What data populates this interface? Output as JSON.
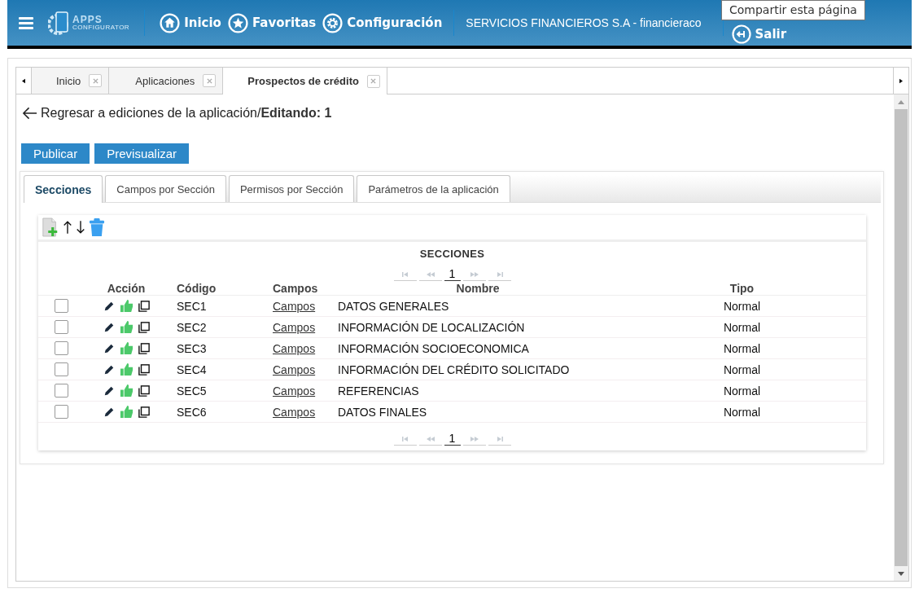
{
  "header": {
    "logo": {
      "line1": "APPS",
      "line2": "CONFIGURATOR"
    },
    "nav": [
      {
        "label": "Inicio",
        "kind": "home"
      },
      {
        "label": "Favoritas",
        "kind": "star"
      },
      {
        "label": "Configuración",
        "kind": "gear"
      }
    ],
    "company": "SERVICIOS FINANCIEROS S.A - financieraco",
    "logout": "Salir",
    "tooltip": "Compartir esta página"
  },
  "doc_tabs": [
    {
      "label": "Inicio",
      "selected": false
    },
    {
      "label": "Aplicaciones",
      "selected": false
    },
    {
      "label": "Prospectos de crédito",
      "selected": true
    }
  ],
  "back_link": "Regresar a ediciones de la aplicación/**Editando: 1**",
  "buttons": [
    "Publicar",
    "Previsualizar"
  ],
  "section_tabs": [
    {
      "label": "Secciones",
      "selected": true
    },
    {
      "label": "Campos por Sección",
      "selected": false
    },
    {
      "label": "Permisos por Sección",
      "selected": false
    },
    {
      "label": "Parámetros de la aplicación",
      "selected": false
    }
  ],
  "grid": {
    "title": "SECCIONES",
    "pager_top_page": "1",
    "pager_bottom_page": "1",
    "columns": [
      "Acción",
      "Código",
      "Campos",
      "Nombre",
      "Tipo"
    ],
    "rows": [
      {
        "checked": false,
        "code": "SEC1",
        "link": "Campos",
        "name": "DATOS GENERALES",
        "type": "Normal"
      },
      {
        "checked": false,
        "code": "SEC2",
        "link": "Campos",
        "name": "INFORMACIÓN DE LOCALIZACIÓN",
        "type": "Normal"
      },
      {
        "checked": false,
        "code": "SEC3",
        "link": "Campos",
        "name": "INFORMACIÓN SOCIOECONOMICA",
        "type": "Normal"
      },
      {
        "checked": false,
        "code": "SEC4",
        "link": "Campos",
        "name": "INFORMACIÓN DEL CRÉDITO SOLICITADO",
        "type": "Normal"
      },
      {
        "checked": false,
        "code": "SEC5",
        "link": "Campos",
        "name": "REFERENCIAS",
        "type": "Normal"
      },
      {
        "checked": false,
        "code": "SEC6",
        "link": "Campos",
        "name": "DATOS FINALES",
        "type": "Normal"
      }
    ]
  }
}
